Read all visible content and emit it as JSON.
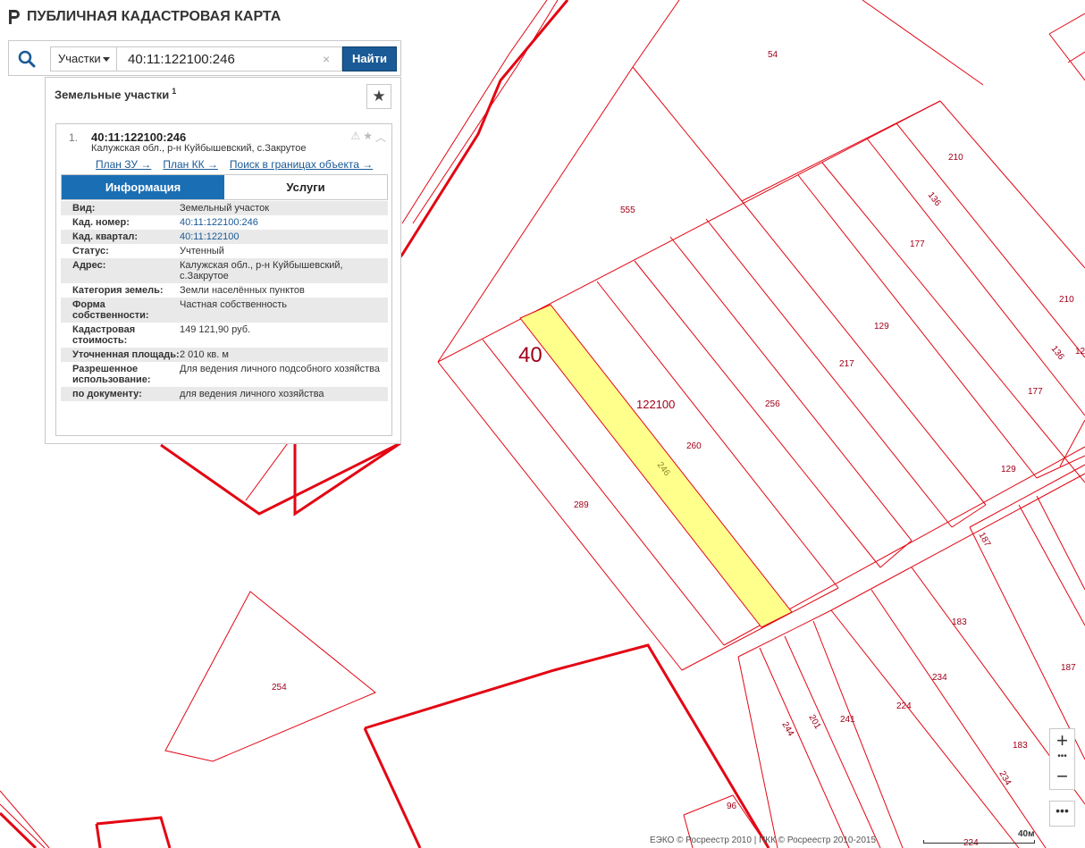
{
  "app": {
    "title": "ПУБЛИЧНАЯ КАДАСТРОВАЯ КАРТА"
  },
  "search": {
    "type_label": "Участки",
    "query": "40:11:122100:246",
    "button": "Найти",
    "clear": "×"
  },
  "results": {
    "title": "Земельные участки",
    "count": "1",
    "items": [
      {
        "num": "1.",
        "cad_number": "40:11:122100:246",
        "address": "Калужская обл., р-н Куйбышевский, с.Закрутое",
        "links": [
          "План ЗУ →",
          "План КК →",
          "Поиск в границах объекта →"
        ]
      }
    ]
  },
  "tabs": [
    "Информация",
    "Услуги"
  ],
  "info": [
    {
      "label": "Вид:",
      "value": "Земельный участок"
    },
    {
      "label": "Кад. номер:",
      "value": "40:11:122100:246"
    },
    {
      "label": "Кад. квартал:",
      "value": "40:11:122100"
    },
    {
      "label": "Статус:",
      "value": "Учтенный"
    },
    {
      "label": "Адрес:",
      "value": "Калужская обл., р-н Куйбышевский, с.Закрутое"
    },
    {
      "label": "Категория земель:",
      "value": "Земли населённых пунктов"
    },
    {
      "label": "Форма собственности:",
      "value": "Частная собственность"
    },
    {
      "label": "Кадастровая стоимость:",
      "value": "149 121,90 руб."
    },
    {
      "label": "Уточненная площадь:",
      "value": "2 010 кв. м"
    },
    {
      "label": "Разрешенное использование:",
      "value": "Для ведения личного подсобного хозяйства"
    },
    {
      "label": "по документу:",
      "value": "для ведения личного хозяйства"
    }
  ],
  "map": {
    "region_label": "40",
    "quarter_label": "122100",
    "highlight_label": "246",
    "colors": {
      "parcel_line": "#e30613",
      "highlight_fill": "#ffff8c",
      "label": "#a0001a"
    },
    "parcel_labels": [
      "54",
      "555",
      "210",
      "136",
      "177",
      "210",
      "129",
      "136",
      "12",
      "217",
      "177",
      "256",
      "260",
      "129",
      "289",
      "187",
      "183",
      "187",
      "234",
      "224",
      "241",
      "201",
      "244",
      "183",
      "234",
      "254",
      "96",
      "224"
    ]
  },
  "controls": {
    "zoom_in": "+",
    "zoom_out": "−",
    "zoom_dots": "•••",
    "more": "•••"
  },
  "footer": {
    "copyright": "ЕЭКО © Росреестр 2010 | ПКК © Росреестр 2010-2015",
    "scale": "40м"
  }
}
